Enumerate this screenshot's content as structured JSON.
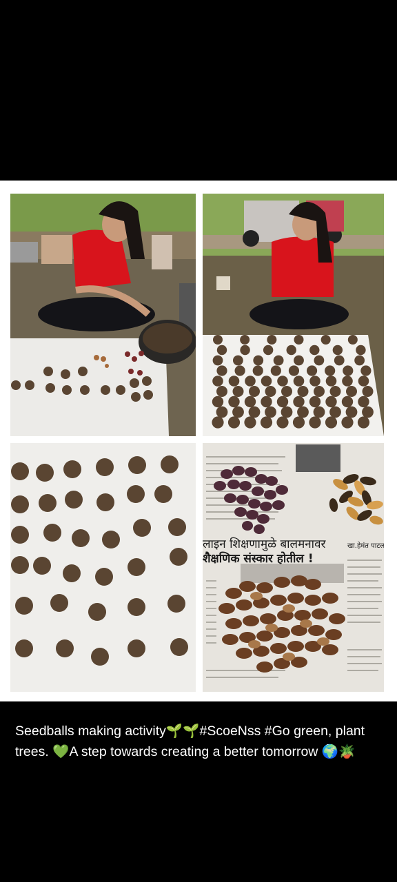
{
  "caption": {
    "text": "Seedballs making activity🌱🌱#ScoeNss #Go green, plant trees. 💚A step towards creating a better tomorrow 🌍🪴"
  },
  "newspaper": {
    "headline_line1": "लाइन शिक्षणामुळे बालमनावर",
    "headline_line2": "शैक्षणिक संस्कार होतील !",
    "byline": "खा.हेमंत पाटल"
  },
  "colors": {
    "background": "#000000",
    "collage_bg": "#ffffff",
    "seedball": "#5a4532",
    "shirt": "#d8141c"
  }
}
